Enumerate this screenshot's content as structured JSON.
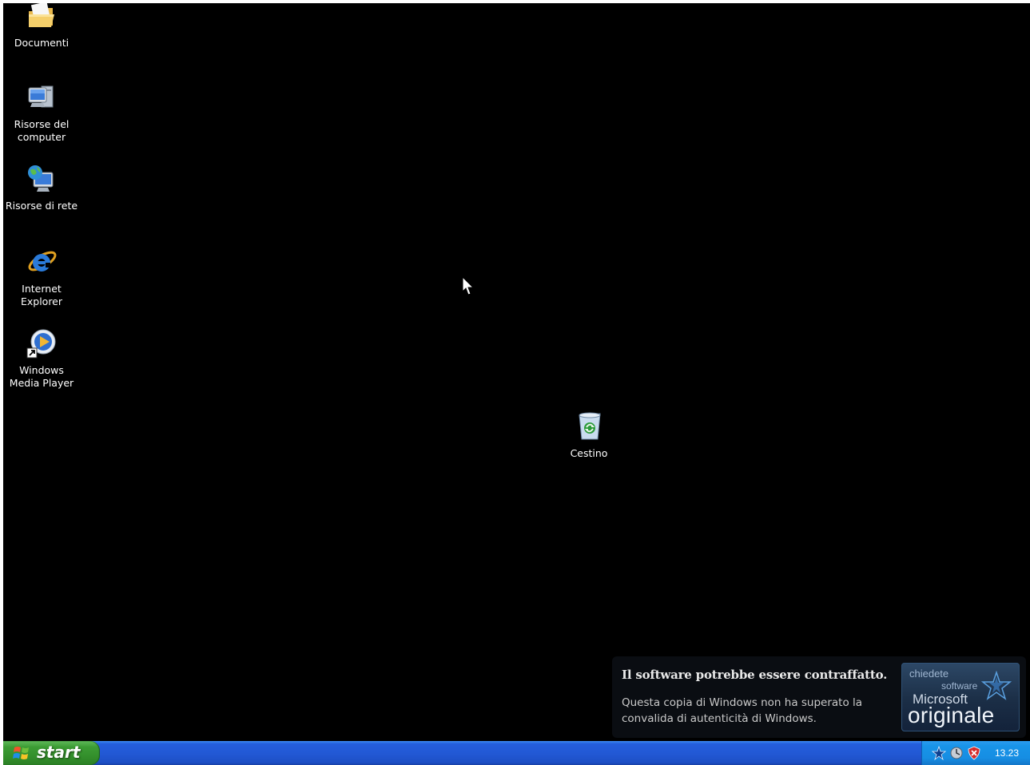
{
  "desktop": {
    "icons": [
      {
        "label": "Documenti",
        "icon": "my-documents-folder-icon"
      },
      {
        "label": "Risorse del computer",
        "icon": "my-computer-icon"
      },
      {
        "label": "Risorse di rete",
        "icon": "network-places-icon"
      },
      {
        "label": "Internet Explorer",
        "icon": "internet-explorer-icon"
      },
      {
        "label": "Windows Media Player",
        "icon": "windows-media-player-icon"
      },
      {
        "label": "Cestino",
        "icon": "recycle-bin-icon"
      }
    ],
    "background_color": "#000000"
  },
  "notification": {
    "title": "Il software potrebbe essere contraffatto.",
    "body": "Questa copia di Windows non ha superato la convalida di autenticità di Windows.",
    "badge": {
      "line1": "chiedete",
      "line2": "software",
      "line3": "Microsoft",
      "line4": "originale"
    }
  },
  "taskbar": {
    "start_label": "start",
    "tray_icons": [
      "genuine-star-icon",
      "network-icon",
      "security-shield-icon"
    ],
    "clock": "13.23",
    "colors": {
      "taskbar": "#245edb",
      "start": "#3c9c34",
      "tray": "#168ee3"
    }
  }
}
